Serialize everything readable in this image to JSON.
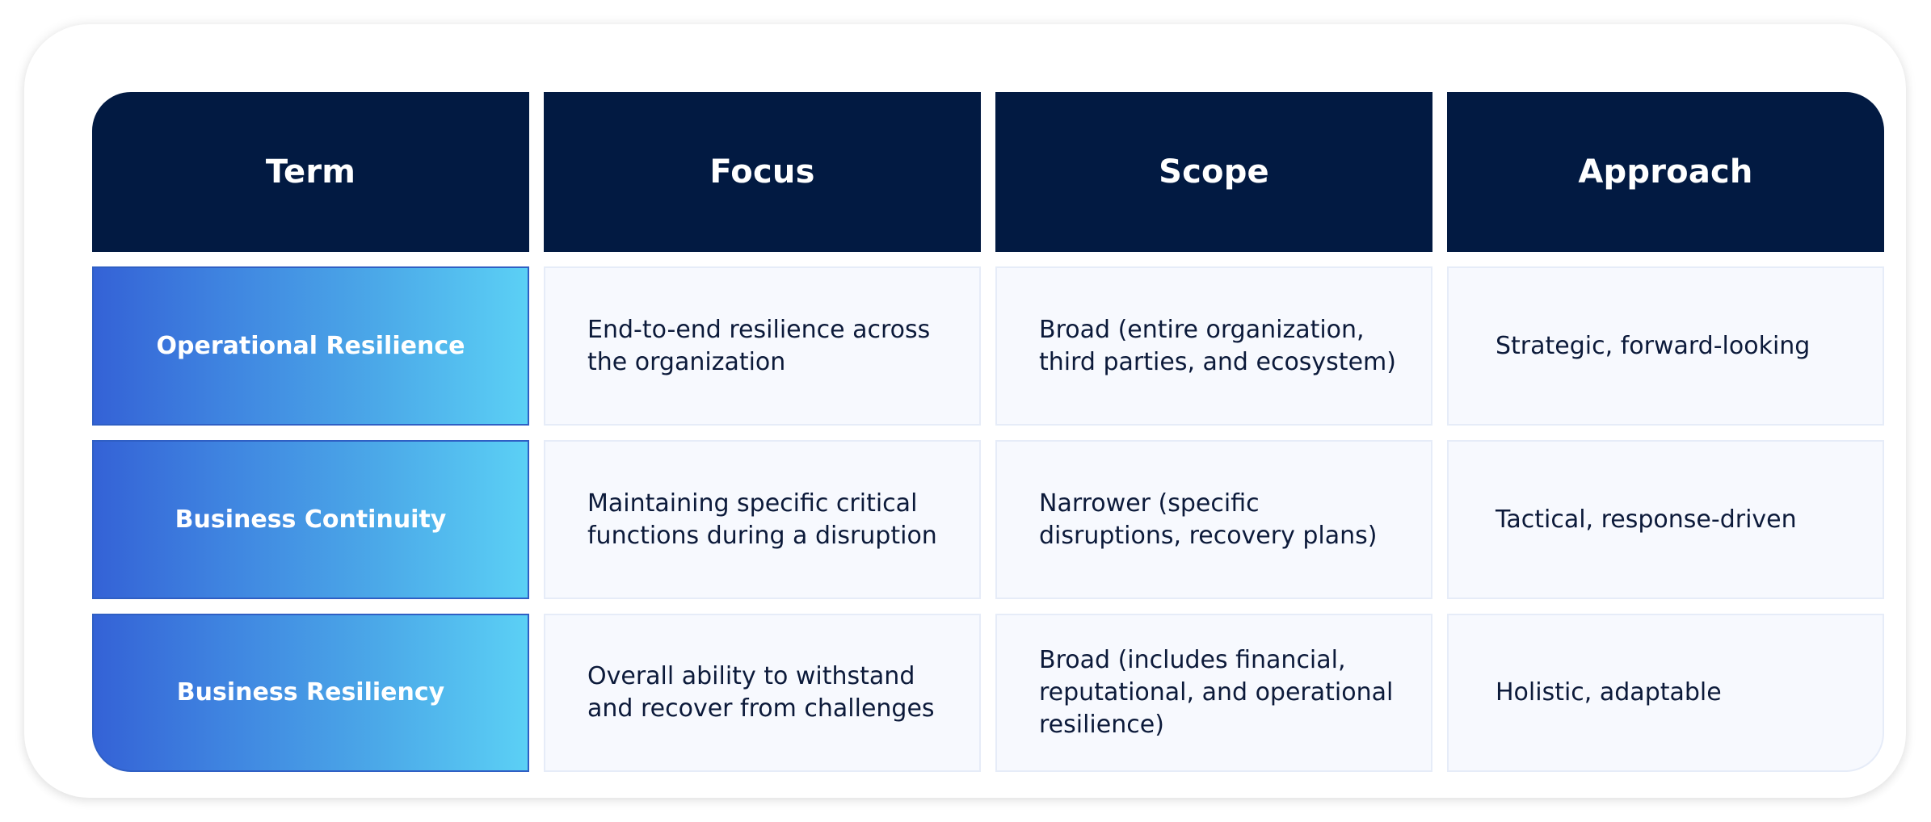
{
  "table": {
    "headers": [
      "Term",
      "Focus",
      "Scope",
      "Approach"
    ],
    "rows": [
      {
        "term": "Operational Resilience",
        "focus": "End-to-end resilience across the organization",
        "scope": "Broad (entire organization, third parties, and ecosystem)",
        "approach": "Strategic, forward-looking"
      },
      {
        "term": "Business Continuity",
        "focus": "Maintaining specific critical functions during a disruption",
        "scope": "Narrower (specific disruptions, recovery plans)",
        "approach": "Tactical, response-driven"
      },
      {
        "term": "Business Resiliency",
        "focus": "Overall ability to withstand and recover from challenges",
        "scope": "Broad (includes financial, reputational, and operational resilience)",
        "approach": "Holistic, adaptable"
      }
    ]
  },
  "colors": {
    "header_bg": "#021a42",
    "term_gradient_start": "#3462d6",
    "term_gradient_end": "#5bd0f5",
    "cell_bg": "#f7f9fe",
    "text": "#0c1a3a"
  }
}
